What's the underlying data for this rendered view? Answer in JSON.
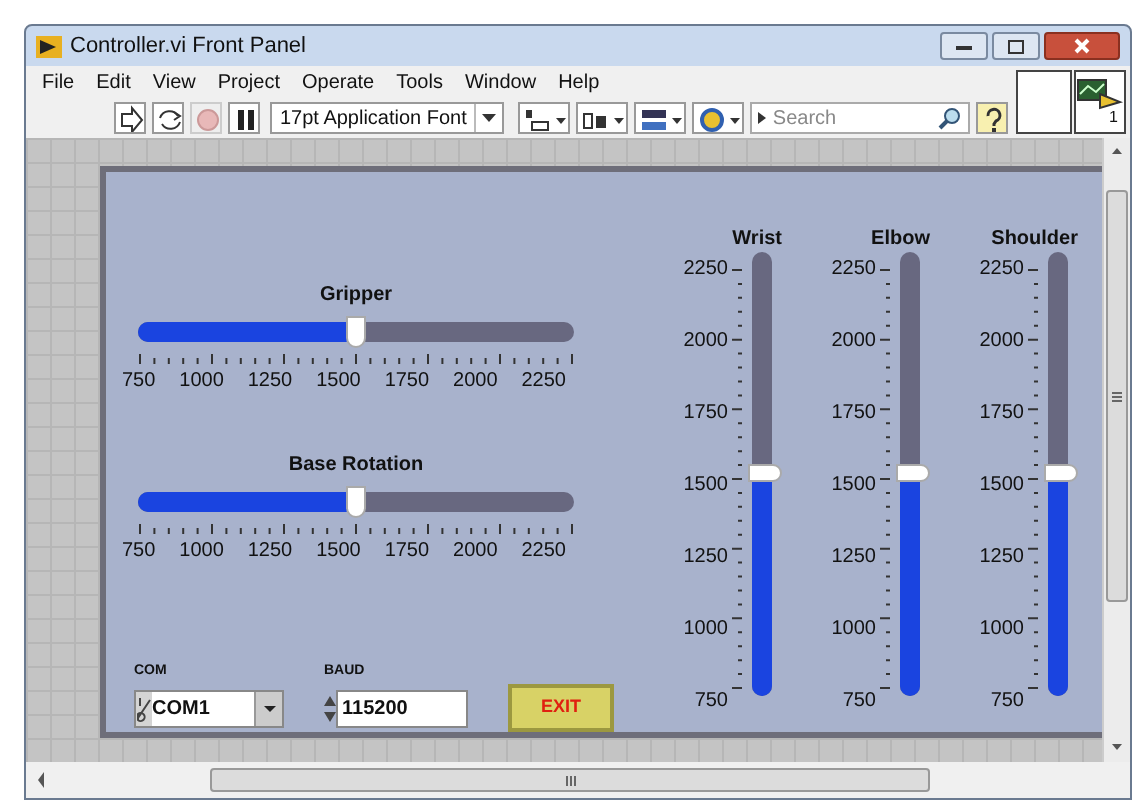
{
  "window": {
    "title": "Controller.vi Front Panel"
  },
  "menu": [
    "File",
    "Edit",
    "View",
    "Project",
    "Operate",
    "Tools",
    "Window",
    "Help"
  ],
  "toolbar": {
    "font": "17pt Application Font",
    "search": {
      "placeholder": "Search"
    },
    "connector_pane": "1"
  },
  "horizontal_sliders": [
    {
      "label": "Gripper",
      "level": 0.5,
      "scale": [
        "750",
        "1000",
        "1250",
        "1500",
        "1750",
        "2000",
        "2250"
      ]
    },
    {
      "label": "Base Rotation",
      "level": 0.5,
      "scale": [
        "750",
        "1000",
        "1250",
        "1500",
        "1750",
        "2000",
        "2250"
      ]
    }
  ],
  "vertical_sliders": [
    {
      "label": "Wrist",
      "level": 0.5,
      "scale": [
        "2250",
        "2000",
        "1750",
        "1500",
        "1250",
        "1000",
        "750"
      ]
    },
    {
      "label": "Elbow",
      "level": 0.5,
      "scale": [
        "2250",
        "2000",
        "1750",
        "1500",
        "1250",
        "1000",
        "750"
      ]
    },
    {
      "label": "Shoulder",
      "level": 0.5,
      "scale": [
        "2250",
        "2000",
        "1750",
        "1500",
        "1250",
        "1000",
        "750"
      ]
    }
  ],
  "com": {
    "label": "COM",
    "value": "COM1"
  },
  "baud": {
    "label": "BAUD",
    "value": "115200"
  },
  "exit_button": {
    "label": "EXIT"
  }
}
